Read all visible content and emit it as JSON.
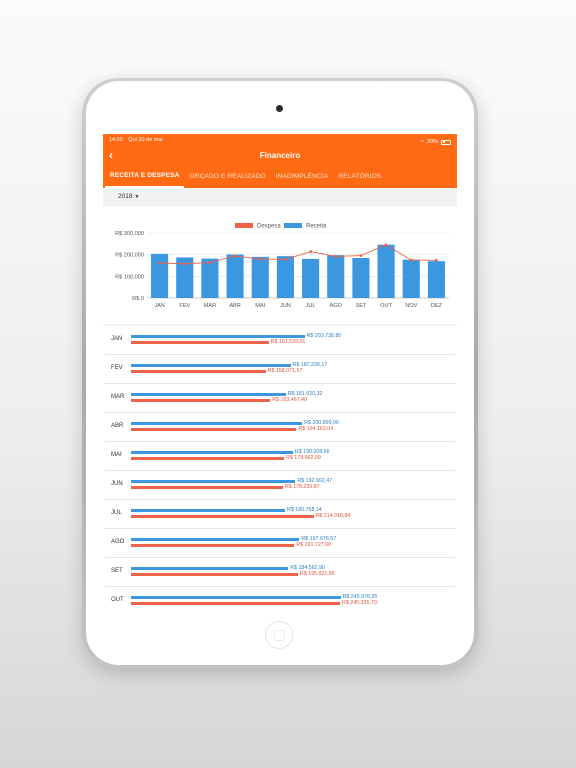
{
  "status": {
    "time": "14:00",
    "date": "Qui 30 de mai",
    "battery": "20%"
  },
  "header": {
    "title": "Financeiro",
    "back_icon": "chevron-left-icon"
  },
  "tabs": [
    {
      "label": "RECEITA E DESPESA",
      "active": true
    },
    {
      "label": "ORÇADO E REALIZADO",
      "active": false
    },
    {
      "label": "INADIMPLÊNCIA",
      "active": false
    },
    {
      "label": "RELATÓRIOS",
      "active": false
    }
  ],
  "filter": {
    "year": "2018"
  },
  "colors": {
    "accent": "#ff6a13",
    "receita": "#3b97df",
    "despesa": "#f0634a"
  },
  "chart_data": {
    "type": "bar",
    "legend": [
      "Despesa",
      "Receita"
    ],
    "legend_position": "top-center",
    "categories": [
      "JAN",
      "FEV",
      "MAR",
      "ABR",
      "MAI",
      "JUN",
      "JUL",
      "AGO",
      "SET",
      "OUT",
      "NOV",
      "DEZ"
    ],
    "yticks": [
      "R$ 300,000",
      "R$ 200,000",
      "R$ 100,000",
      "R$ 0"
    ],
    "ylim": [
      0,
      300000
    ],
    "grid": true,
    "series": [
      {
        "name": "Receita",
        "kind": "bar",
        "values": [
          203738.8,
          187236.17,
          181620.32,
          200899.06,
          190008.66,
          192992.47,
          180758.14,
          197676.57,
          184562.9,
          245976.35,
          177000,
          170000
        ]
      },
      {
        "name": "Despesa",
        "kind": "line",
        "values": [
          161539.01,
          158071.57,
          163467.4,
          194163.04,
          179662.99,
          178239.87,
          214318.84,
          191727.66,
          195921.86,
          245326.7,
          175000,
          174000
        ]
      }
    ]
  },
  "rows": [
    {
      "month": "JAN",
      "receita": "R$ 203.738,80",
      "despesa": "R$ 161.539,01",
      "r": 203738.8,
      "d": 161539.01
    },
    {
      "month": "FEV",
      "receita": "R$ 187.236,17",
      "despesa": "R$ 158.071,57",
      "r": 187236.17,
      "d": 158071.57
    },
    {
      "month": "MAR",
      "receita": "R$ 181.620,32",
      "despesa": "R$ 163.467,40",
      "r": 181620.32,
      "d": 163467.4
    },
    {
      "month": "ABR",
      "receita": "R$ 200.899,06",
      "despesa": "R$ 194.163,04",
      "r": 200899.06,
      "d": 194163.04
    },
    {
      "month": "MAI",
      "receita": "R$ 190.008,66",
      "despesa": "R$ 179.662,99",
      "r": 190008.66,
      "d": 179662.99
    },
    {
      "month": "JUN",
      "receita": "R$ 192.992,47",
      "despesa": "R$ 178.239,87",
      "r": 192992.47,
      "d": 178239.87
    },
    {
      "month": "JUL",
      "receita": "R$ 180.758,14",
      "despesa": "R$ 214.318,84",
      "r": 180758.14,
      "d": 214318.84
    },
    {
      "month": "AGO",
      "receita": "R$ 197.676,57",
      "despesa": "R$ 191.727,66",
      "r": 197676.57,
      "d": 191727.66
    },
    {
      "month": "SET",
      "receita": "R$ 184.562,90",
      "despesa": "R$ 195.921,86",
      "r": 184562.9,
      "d": 195921.86
    },
    {
      "month": "OUT",
      "receita": "R$ 245.976,35",
      "despesa": "R$ 245.326,70",
      "r": 245976.35,
      "d": 245326.7
    }
  ]
}
